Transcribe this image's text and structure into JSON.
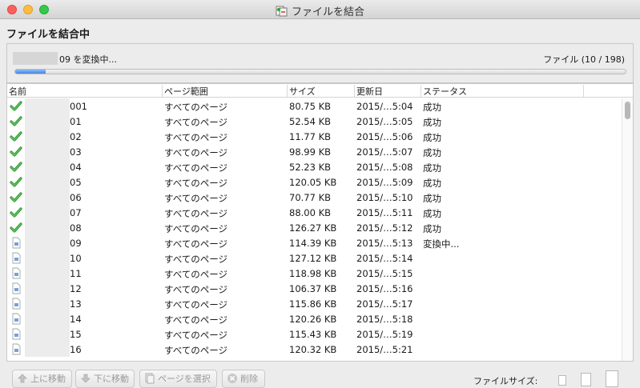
{
  "window": {
    "title": "ファイルを結合"
  },
  "heading": "ファイルを結合中",
  "progress": {
    "text": "09 を変換中...",
    "count": "ファイル (10 / 198)",
    "fraction": 0.05
  },
  "columns": {
    "name": "名前",
    "range": "ページ範囲",
    "size": "サイズ",
    "date": "更新日",
    "status": "ステータス"
  },
  "rows": [
    {
      "icon": "check-icon",
      "name": "001",
      "range": "すべてのページ",
      "size": "80.75 KB",
      "date": "2015/…5:04",
      "status": "成功"
    },
    {
      "icon": "check-icon",
      "name": "01",
      "range": "すべてのページ",
      "size": "52.54 KB",
      "date": "2015/…5:05",
      "status": "成功"
    },
    {
      "icon": "check-icon",
      "name": "02",
      "range": "すべてのページ",
      "size": "11.77 KB",
      "date": "2015/…5:06",
      "status": "成功"
    },
    {
      "icon": "check-icon",
      "name": "03",
      "range": "すべてのページ",
      "size": "98.99 KB",
      "date": "2015/…5:07",
      "status": "成功"
    },
    {
      "icon": "check-icon",
      "name": "04",
      "range": "すべてのページ",
      "size": "52.23 KB",
      "date": "2015/…5:08",
      "status": "成功"
    },
    {
      "icon": "check-icon",
      "name": "05",
      "range": "すべてのページ",
      "size": "120.05 KB",
      "date": "2015/…5:09",
      "status": "成功"
    },
    {
      "icon": "check-icon",
      "name": "06",
      "range": "すべてのページ",
      "size": "70.77 KB",
      "date": "2015/…5:10",
      "status": "成功"
    },
    {
      "icon": "check-icon",
      "name": "07",
      "range": "すべてのページ",
      "size": "88.00 KB",
      "date": "2015/…5:11",
      "status": "成功"
    },
    {
      "icon": "check-icon",
      "name": "08",
      "range": "すべてのページ",
      "size": "126.27 KB",
      "date": "2015/…5:12",
      "status": "成功"
    },
    {
      "icon": "file-icon",
      "name": "09",
      "range": "すべてのページ",
      "size": "114.39 KB",
      "date": "2015/…5:13",
      "status": "変換中..."
    },
    {
      "icon": "file-icon",
      "name": "10",
      "range": "すべてのページ",
      "size": "127.12 KB",
      "date": "2015/…5:14",
      "status": ""
    },
    {
      "icon": "file-icon",
      "name": "11",
      "range": "すべてのページ",
      "size": "118.98 KB",
      "date": "2015/…5:15",
      "status": ""
    },
    {
      "icon": "file-icon",
      "name": "12",
      "range": "すべてのページ",
      "size": "106.37 KB",
      "date": "2015/…5:16",
      "status": ""
    },
    {
      "icon": "file-icon",
      "name": "13",
      "range": "すべてのページ",
      "size": "115.86 KB",
      "date": "2015/…5:17",
      "status": ""
    },
    {
      "icon": "file-icon",
      "name": "14",
      "range": "すべてのページ",
      "size": "120.26 KB",
      "date": "2015/…5:18",
      "status": ""
    },
    {
      "icon": "file-icon",
      "name": "15",
      "range": "すべてのページ",
      "size": "115.43 KB",
      "date": "2015/…5:19",
      "status": ""
    },
    {
      "icon": "file-icon",
      "name": "16",
      "range": "すべてのページ",
      "size": "120.32 KB",
      "date": "2015/…5:21",
      "status": ""
    }
  ],
  "footer": {
    "move_up": "上に移動",
    "move_down": "下に移動",
    "select_pages": "ページを選択",
    "delete": "削除",
    "file_size_label": "ファイルサイズ:"
  },
  "colors": {
    "accent": "#3f86ea",
    "check": "#3aa83a"
  }
}
